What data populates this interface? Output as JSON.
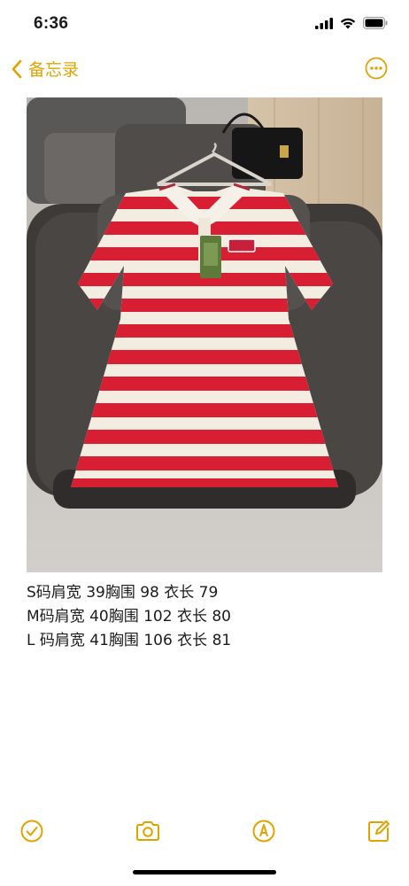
{
  "status": {
    "time": "6:36"
  },
  "nav": {
    "back_label": "备忘录"
  },
  "note": {
    "lines": [
      "S码肩宽 39胸围 98 衣长 79",
      "M码肩宽 40胸围 102 衣长 80",
      "L 码肩宽 41胸围 106 衣长 81"
    ]
  },
  "colors": {
    "accent": "#e0a300",
    "stripe_red": "#d81e33",
    "stripe_cream": "#f3ece0"
  },
  "icons": {
    "status": [
      "signal-icon",
      "wifi-icon",
      "battery-icon"
    ],
    "toolbar": [
      "checklist-icon",
      "camera-icon",
      "markup-pen-icon",
      "compose-icon"
    ]
  }
}
